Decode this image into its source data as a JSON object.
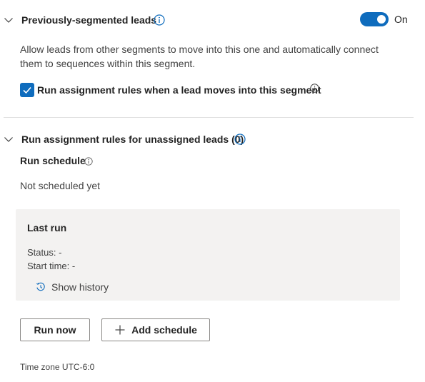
{
  "section_segmented": {
    "title": "Previously-segmented leads",
    "toggle_state_label": "On",
    "toggle_on": true,
    "description": "Allow leads from other segments to move into this one and automatically connect them to sequences within this segment.",
    "checkbox_label": "Run assignment rules when a lead moves into this segment",
    "checkbox_checked": true
  },
  "section_unassigned": {
    "title": "Run assignment rules for unassigned leads (0)",
    "run_schedule_label": "Run schedule",
    "schedule_status": "Not scheduled yet",
    "last_run": {
      "title": "Last run",
      "status": "Status: -",
      "start_time": "Start time: -",
      "show_history_label": "Show history"
    },
    "buttons": {
      "run_now": "Run now",
      "add_schedule": "Add schedule"
    },
    "timezone": "Time zone UTC-6:0"
  },
  "colors": {
    "accent": "#0f6cbd",
    "panel_bg": "#f3f2f1",
    "divider": "#e0e0e0"
  }
}
